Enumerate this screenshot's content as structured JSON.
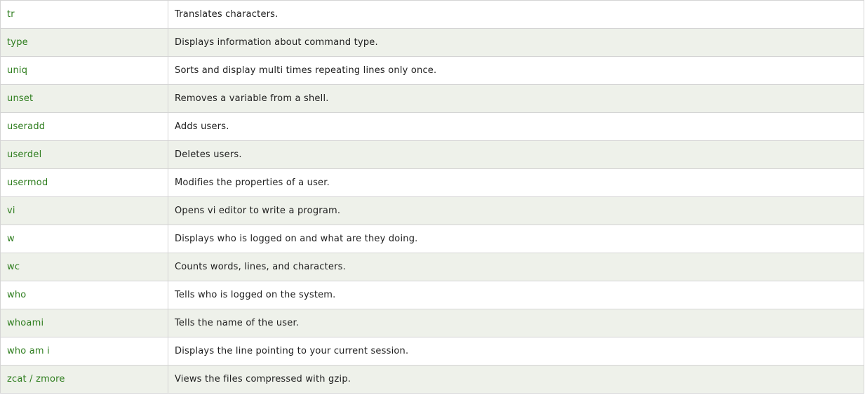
{
  "colors": {
    "command_text": "#2e7d1e",
    "description_text": "#1e1e1e",
    "row_alt_background": "#eef1ea",
    "row_background": "#ffffff",
    "border": "#d4d4d4"
  },
  "rows": [
    {
      "command": "tr",
      "description": "Translates characters."
    },
    {
      "command": "type",
      "description": "Displays information about command type."
    },
    {
      "command": "uniq",
      "description": "Sorts and display multi times repeating lines only once."
    },
    {
      "command": "unset",
      "description": "Removes a variable from a shell."
    },
    {
      "command": "useradd",
      "description": "Adds users."
    },
    {
      "command": "userdel",
      "description": "Deletes users."
    },
    {
      "command": "usermod",
      "description": "Modifies the properties of a user."
    },
    {
      "command": "vi",
      "description": "Opens vi editor to write a program."
    },
    {
      "command": "w",
      "description": "Displays who is logged on and what are they doing."
    },
    {
      "command": "wc",
      "description": "Counts words, lines, and characters."
    },
    {
      "command": "who",
      "description": "Tells who is logged on the system."
    },
    {
      "command": "whoami",
      "description": "Tells the name of the user."
    },
    {
      "command": "who am i",
      "description": "Displays the line pointing to your current session."
    },
    {
      "command": "zcat / zmore",
      "description": "Views the files compressed with gzip."
    }
  ]
}
